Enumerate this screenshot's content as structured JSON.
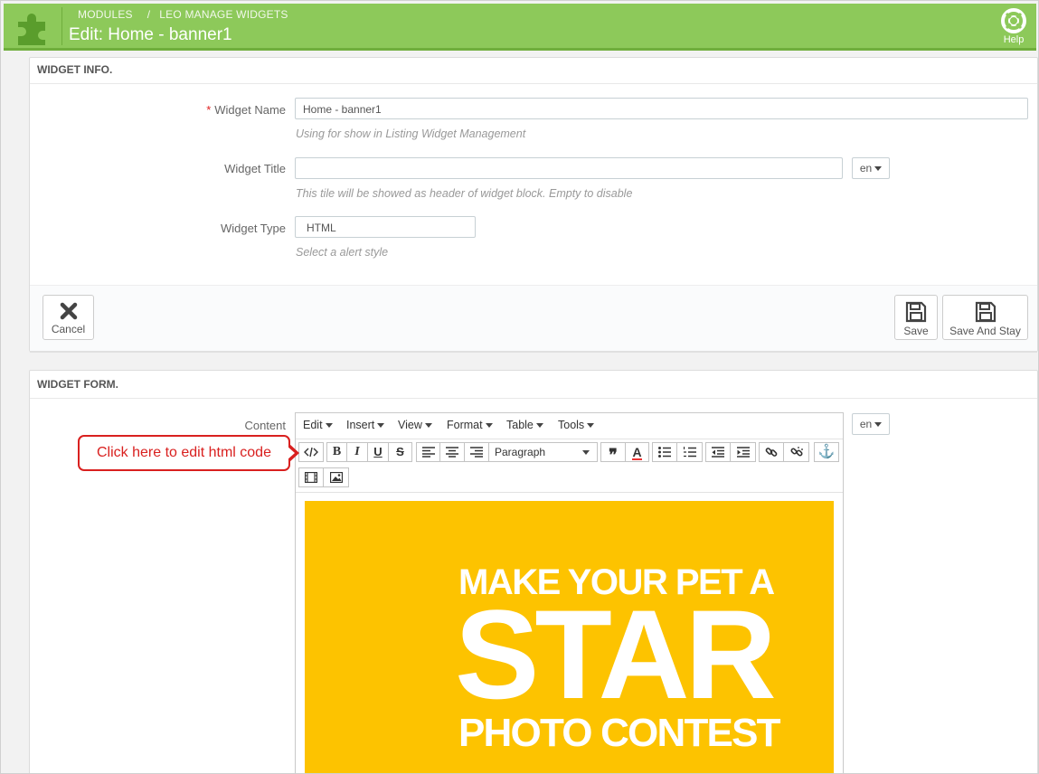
{
  "header": {
    "breadcrumb": [
      "MODULES",
      "/",
      "LEO MANAGE WIDGETS"
    ],
    "title": "Edit: Home - banner1",
    "help_label": "Help",
    "color": "#8dc95a"
  },
  "widget_info": {
    "heading": "WIDGET INFO.",
    "name": {
      "label": "Widget Name",
      "required_mark": "*",
      "value": "Home - banner1",
      "hint": "Using for show in Listing Widget Management"
    },
    "title": {
      "label": "Widget Title",
      "value": "",
      "hint": "This tile will be showed as header of widget block. Empty to disable",
      "lang": "en"
    },
    "type": {
      "label": "Widget Type",
      "value": "HTML",
      "hint": "Select a alert style"
    },
    "cancel_label": "Cancel",
    "save_label": "Save",
    "save_stay_label": "Save And Stay"
  },
  "widget_form": {
    "heading": "WIDGET FORM.",
    "content_label": "Content",
    "lang": "en",
    "menus": [
      "Edit",
      "Insert",
      "View",
      "Format",
      "Table",
      "Tools"
    ],
    "block_format": "Paragraph",
    "toolbar_icons": [
      "source-code-icon",
      "bold-icon",
      "italic-icon",
      "underline-icon",
      "strikethrough-icon",
      "align-left-icon",
      "align-center-icon",
      "align-right-icon",
      "blockquote-icon",
      "text-color-icon",
      "bullet-list-icon",
      "numbered-list-icon",
      "outdent-icon",
      "indent-icon",
      "link-icon",
      "unlink-icon",
      "anchor-icon",
      "media-icon",
      "image-icon"
    ],
    "banner": {
      "line1": "MAKE YOUR PET A",
      "line2": "STAR",
      "line3": "PHOTO CONTEST",
      "color": "#fdc300"
    }
  },
  "callout": {
    "text": "Click here to edit html code",
    "color": "#d9201f"
  }
}
